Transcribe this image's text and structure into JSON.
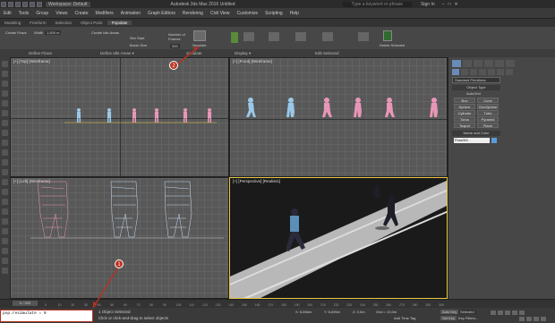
{
  "titlebar": {
    "workspace": "Workspace: Default",
    "title": "Autodesk 3ds Max 2016   Untitled",
    "search_placeholder": "Type a keyword or phrase",
    "signin": "Sign In"
  },
  "menu": [
    "Edit",
    "Tools",
    "Group",
    "Views",
    "Create",
    "Modifiers",
    "Animation",
    "Graph Editors",
    "Rendering",
    "Civil View",
    "Customize",
    "Scripting",
    "Help"
  ],
  "ribbon_tabs": [
    "Modeling",
    "Freeform",
    "Selection",
    "Object Paint",
    "Populate"
  ],
  "ribbon_active_tab": "Populate",
  "ribbon": {
    "create_flows": "Create Flows",
    "width_label": "Width",
    "width_value": "1,500 m",
    "create_idle_areas": "Create Idle Areas",
    "sim_start_label": "Sim Start",
    "brush_size_label": "Brush Size",
    "number_of_frames": "Number of Frames",
    "frames_value": "300",
    "simulate_label": "Simulate",
    "display_label": "Display",
    "edit_selected_label": "Edit Selected",
    "delete_selected": "Delete Selected",
    "footer_define_flows": "Define Flows",
    "footer_define_idle": "Define Idle Areas ▾",
    "footer_simulate": "Simulate",
    "footer_display": "Display ▾",
    "footer_edit_selected": "Edit Selected"
  },
  "viewports": {
    "top": "[+] [Top] [Wireframe]",
    "front": "[+] [Front] [Wireframe]",
    "left": "[+] [Left] [Wireframe]",
    "perspective": "[+] [Perspective] [Realistic]"
  },
  "command_panel": {
    "dropdown": "Standard Primitives",
    "object_type_header": "Object Type",
    "autogrid": "AutoGrid",
    "buttons": [
      "Box",
      "Cone",
      "Sphere",
      "GeoSphere",
      "Cylinder",
      "Tube",
      "Torus",
      "Pyramid",
      "Teapot",
      "Plane"
    ],
    "name_color_header": "Name and Color",
    "name_value": "Flow001"
  },
  "timeline": {
    "frame": "0 / 300",
    "ticks": [
      "0",
      "10",
      "20",
      "30",
      "40",
      "50",
      "60",
      "70",
      "80",
      "90",
      "100",
      "110",
      "120",
      "130",
      "140",
      "150",
      "160",
      "170",
      "180",
      "190",
      "200",
      "210",
      "220",
      "230",
      "240",
      "250",
      "260",
      "270",
      "280",
      "290",
      "300"
    ]
  },
  "status": {
    "maxscript": "pop.resimulate = 0",
    "selected": "1 Object Selected",
    "prompt": "Click or click-and-drag to select objects",
    "x": "X: 5,656m",
    "y": "Y: 6,696m",
    "z": "Z: 0,0m",
    "grid": "Grid = 10,0m",
    "addtime": "Add Time Tag",
    "autokey": "Auto Key",
    "selected_dd": "Selected",
    "setkey": "Set Key",
    "keyfilters": "Key Filters..."
  },
  "callouts": [
    "2",
    "1"
  ],
  "colors": {
    "accent_red": "#b33322",
    "pink_figure": "#e896b8",
    "blue_figure": "#9ac8e8",
    "selection_yellow": "#e8c840"
  }
}
